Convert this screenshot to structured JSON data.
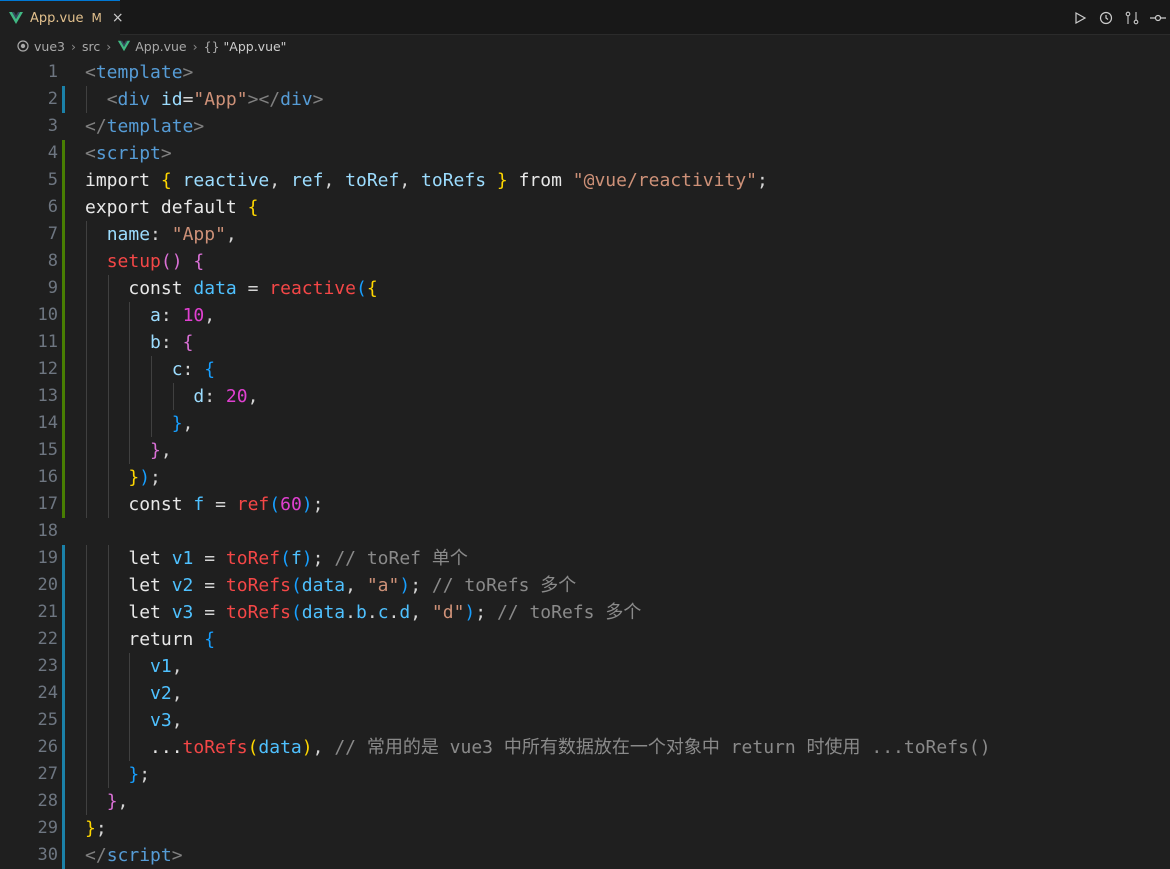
{
  "tab": {
    "label": "App.vue",
    "modified": "M",
    "close": "×"
  },
  "breadcrumb": {
    "folder": "vue3",
    "sub": "src",
    "file": "App.vue",
    "symbol": "\"App.vue\"",
    "symbol_icon": "{}"
  },
  "actions": [
    "run-icon",
    "history-icon",
    "compare-changes-icon",
    "source-control-icon"
  ],
  "lines": [
    {
      "n": "1"
    },
    {
      "n": "2"
    },
    {
      "n": "3"
    },
    {
      "n": "4"
    },
    {
      "n": "5"
    },
    {
      "n": "6"
    },
    {
      "n": "7"
    },
    {
      "n": "8"
    },
    {
      "n": "9"
    },
    {
      "n": "10"
    },
    {
      "n": "11"
    },
    {
      "n": "12"
    },
    {
      "n": "13"
    },
    {
      "n": "14"
    },
    {
      "n": "15"
    },
    {
      "n": "16"
    },
    {
      "n": "17"
    },
    {
      "n": "18"
    },
    {
      "n": "19"
    },
    {
      "n": "20"
    },
    {
      "n": "21"
    },
    {
      "n": "22"
    },
    {
      "n": "23"
    },
    {
      "n": "24"
    },
    {
      "n": "25"
    },
    {
      "n": "26"
    },
    {
      "n": "27"
    },
    {
      "n": "28"
    },
    {
      "n": "29"
    },
    {
      "n": "30"
    }
  ],
  "code": {
    "l1": [
      [
        "tag",
        "<"
      ],
      [
        "tn",
        "template"
      ],
      [
        "tag",
        ">"
      ]
    ],
    "l2": [
      [
        "plain",
        "  "
      ],
      [
        "tag",
        "<"
      ],
      [
        "tn",
        "div"
      ],
      [
        "plain",
        " "
      ],
      [
        "attr",
        "id"
      ],
      [
        "plain",
        "="
      ],
      [
        "str",
        "\"App\""
      ],
      [
        "tag",
        "></"
      ],
      [
        "tn",
        "div"
      ],
      [
        "tag",
        ">"
      ]
    ],
    "l3": [
      [
        "tag",
        "</"
      ],
      [
        "tn",
        "template"
      ],
      [
        "tag",
        ">"
      ]
    ],
    "l4": [
      [
        "tag",
        "<"
      ],
      [
        "tn",
        "script"
      ],
      [
        "tag",
        ">"
      ]
    ],
    "l5": [
      [
        "white",
        "import "
      ],
      [
        "br1",
        "{ "
      ],
      [
        "attr",
        "reactive"
      ],
      [
        "plain",
        ", "
      ],
      [
        "attr",
        "ref"
      ],
      [
        "plain",
        ", "
      ],
      [
        "attr",
        "toRef"
      ],
      [
        "plain",
        ", "
      ],
      [
        "attr",
        "toRefs"
      ],
      [
        "br1",
        " }"
      ],
      [
        "white",
        " from "
      ],
      [
        "str",
        "\"@vue/reactivity\""
      ],
      [
        "plain",
        ";"
      ]
    ],
    "l6": [
      [
        "white",
        "export default "
      ],
      [
        "br1",
        "{"
      ]
    ],
    "l7": [
      [
        "plain",
        "  "
      ],
      [
        "prop",
        "name"
      ],
      [
        "plain",
        ": "
      ],
      [
        "str",
        "\"App\""
      ],
      [
        "plain",
        ","
      ]
    ],
    "l8": [
      [
        "plain",
        "  "
      ],
      [
        "fn",
        "setup"
      ],
      [
        "br2",
        "()"
      ],
      [
        "plain",
        " "
      ],
      [
        "br2",
        "{"
      ]
    ],
    "l9": [
      [
        "plain",
        "    "
      ],
      [
        "white",
        "const "
      ],
      [
        "var",
        "data"
      ],
      [
        "plain",
        " = "
      ],
      [
        "fn",
        "reactive"
      ],
      [
        "br3",
        "("
      ],
      [
        "br1",
        "{"
      ]
    ],
    "l10": [
      [
        "plain",
        "      "
      ],
      [
        "prop",
        "a"
      ],
      [
        "plain",
        ": "
      ],
      [
        "num",
        "10"
      ],
      [
        "plain",
        ","
      ]
    ],
    "l11": [
      [
        "plain",
        "      "
      ],
      [
        "prop",
        "b"
      ],
      [
        "plain",
        ": "
      ],
      [
        "br2",
        "{"
      ]
    ],
    "l12": [
      [
        "plain",
        "        "
      ],
      [
        "prop",
        "c"
      ],
      [
        "plain",
        ": "
      ],
      [
        "br3",
        "{"
      ]
    ],
    "l13": [
      [
        "plain",
        "          "
      ],
      [
        "prop",
        "d"
      ],
      [
        "plain",
        ": "
      ],
      [
        "num",
        "20"
      ],
      [
        "plain",
        ","
      ]
    ],
    "l14": [
      [
        "plain",
        "        "
      ],
      [
        "br3",
        "}"
      ],
      [
        "plain",
        ","
      ]
    ],
    "l15": [
      [
        "plain",
        "      "
      ],
      [
        "br2",
        "}"
      ],
      [
        "plain",
        ","
      ]
    ],
    "l16": [
      [
        "plain",
        "    "
      ],
      [
        "br1",
        "}"
      ],
      [
        "br3",
        ")"
      ],
      [
        "plain",
        ";"
      ]
    ],
    "l17": [
      [
        "plain",
        "    "
      ],
      [
        "white",
        "const "
      ],
      [
        "var",
        "f"
      ],
      [
        "plain",
        " = "
      ],
      [
        "fn",
        "ref"
      ],
      [
        "br3",
        "("
      ],
      [
        "num",
        "60"
      ],
      [
        "br3",
        ")"
      ],
      [
        "plain",
        ";"
      ]
    ],
    "l18": [
      [
        "plain",
        ""
      ]
    ],
    "l19": [
      [
        "plain",
        "    "
      ],
      [
        "white",
        "let "
      ],
      [
        "var",
        "v1"
      ],
      [
        "plain",
        " = "
      ],
      [
        "fn",
        "toRef"
      ],
      [
        "br3",
        "("
      ],
      [
        "var",
        "f"
      ],
      [
        "br3",
        ")"
      ],
      [
        "plain",
        "; "
      ],
      [
        "cmt",
        "// toRef 单个"
      ]
    ],
    "l20": [
      [
        "plain",
        "    "
      ],
      [
        "white",
        "let "
      ],
      [
        "var",
        "v2"
      ],
      [
        "plain",
        " = "
      ],
      [
        "fn",
        "toRefs"
      ],
      [
        "br3",
        "("
      ],
      [
        "var",
        "data"
      ],
      [
        "plain",
        ", "
      ],
      [
        "str",
        "\"a\""
      ],
      [
        "br3",
        ")"
      ],
      [
        "plain",
        "; "
      ],
      [
        "cmt",
        "// toRefs 多个"
      ]
    ],
    "l21": [
      [
        "plain",
        "    "
      ],
      [
        "white",
        "let "
      ],
      [
        "var",
        "v3"
      ],
      [
        "plain",
        " = "
      ],
      [
        "fn",
        "toRefs"
      ],
      [
        "br3",
        "("
      ],
      [
        "var",
        "data"
      ],
      [
        "plain",
        "."
      ],
      [
        "var",
        "b"
      ],
      [
        "plain",
        "."
      ],
      [
        "var",
        "c"
      ],
      [
        "plain",
        "."
      ],
      [
        "var",
        "d"
      ],
      [
        "plain",
        ", "
      ],
      [
        "str",
        "\"d\""
      ],
      [
        "br3",
        ")"
      ],
      [
        "plain",
        "; "
      ],
      [
        "cmt",
        "// toRefs 多个"
      ]
    ],
    "l22": [
      [
        "plain",
        "    "
      ],
      [
        "white",
        "return "
      ],
      [
        "br3",
        "{"
      ]
    ],
    "l23": [
      [
        "plain",
        "      "
      ],
      [
        "var",
        "v1"
      ],
      [
        "plain",
        ","
      ]
    ],
    "l24": [
      [
        "plain",
        "      "
      ],
      [
        "var",
        "v2"
      ],
      [
        "plain",
        ","
      ]
    ],
    "l25": [
      [
        "plain",
        "      "
      ],
      [
        "var",
        "v3"
      ],
      [
        "plain",
        ","
      ]
    ],
    "l26": [
      [
        "plain",
        "      "
      ],
      [
        "white",
        "..."
      ],
      [
        "fn",
        "toRefs"
      ],
      [
        "br1",
        "("
      ],
      [
        "var",
        "data"
      ],
      [
        "br1",
        ")"
      ],
      [
        "plain",
        ", "
      ],
      [
        "cmt",
        "// 常用的是 vue3 中所有数据放在一个对象中 return 时使用 ...toRefs()"
      ]
    ],
    "l27": [
      [
        "plain",
        "    "
      ],
      [
        "br3",
        "}"
      ],
      [
        "plain",
        ";"
      ]
    ],
    "l28": [
      [
        "plain",
        "  "
      ],
      [
        "br2",
        "}"
      ],
      [
        "plain",
        ","
      ]
    ],
    "l29": [
      [
        "br1",
        "}"
      ],
      [
        "plain",
        ";"
      ]
    ],
    "l30": [
      [
        "tag",
        "</"
      ],
      [
        "tn",
        "script"
      ],
      [
        "tag",
        ">"
      ]
    ]
  },
  "gutter": {
    "2": "mod",
    "4": "add",
    "5": "add",
    "6": "add",
    "7": "add",
    "8": "add",
    "9": "add",
    "10": "add",
    "11": "add",
    "12": "add",
    "13": "add",
    "14": "add",
    "15": "add",
    "16": "add",
    "17": "add",
    "19": "mod",
    "20": "mod",
    "21": "mod",
    "22": "mod",
    "23": "mod",
    "24": "mod",
    "25": "mod",
    "26": "mod",
    "27": "mod",
    "28": "mod",
    "29": "mod",
    "30": "mod"
  }
}
